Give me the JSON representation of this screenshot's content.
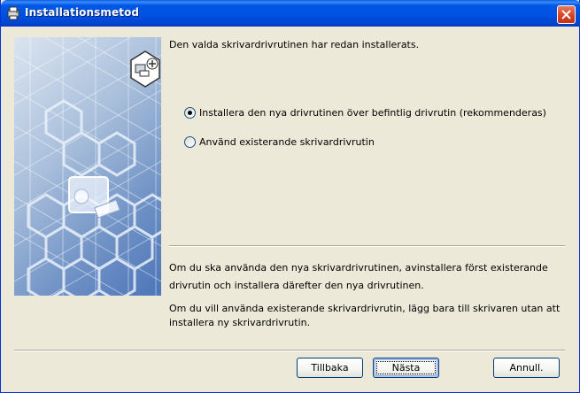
{
  "window": {
    "title": "Installationsmetod",
    "close_icon": "close-x-icon",
    "app_icon": "printer-setup-icon"
  },
  "header_text": "Den valda skrivardrivrutinen har redan installerats.",
  "options": [
    {
      "label": "Installera den nya drivrutinen över befintlig drivrutin (rekommenderas)",
      "selected": true
    },
    {
      "label": "Använd existerande skrivardrivrutin",
      "selected": false
    }
  ],
  "info": {
    "paragraph1_line1": "Om du ska använda den nya skrivardrivrutinen, avinstallera först existerande",
    "paragraph1_line2": "drivrutin och installera därefter den nya drivrutinen.",
    "paragraph2_line1": "Om du vill använda existerande skrivardrivrutin, lägg bara till skrivaren utan att",
    "paragraph2_line2": "installera ny skrivardrivrutin."
  },
  "buttons": {
    "back": "Tillbaka",
    "next": "Nästa",
    "cancel": "Annull."
  },
  "colors": {
    "titlebar": "#0054e3",
    "dialog_bg": "#ece9d8",
    "close_button": "#d6401d"
  }
}
